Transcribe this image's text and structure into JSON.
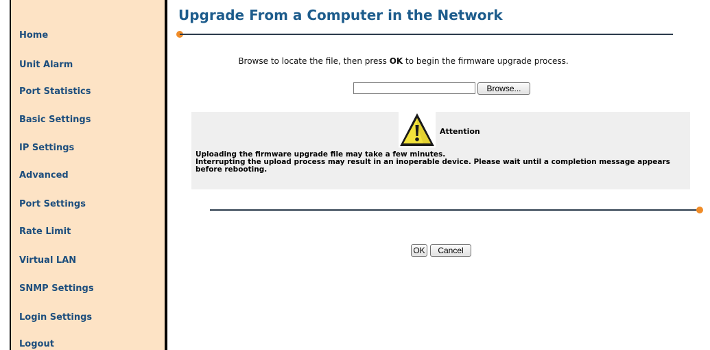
{
  "sidebar": {
    "items": [
      {
        "label": "Home"
      },
      {
        "label": "Unit Alarm"
      },
      {
        "label": "Port Statistics"
      },
      {
        "label": "Basic Settings"
      },
      {
        "label": "IP Settings"
      },
      {
        "label": "Advanced"
      },
      {
        "label": "Port Settings"
      },
      {
        "label": "Rate Limit"
      },
      {
        "label": "Virtual LAN"
      },
      {
        "label": "SNMP Settings"
      },
      {
        "label": "Login Settings"
      },
      {
        "label": "Logout"
      }
    ]
  },
  "main": {
    "title": "Upgrade From a Computer in the Network",
    "instruction_before": "Browse to locate the file, then press ",
    "instruction_bold": "OK",
    "instruction_after": " to begin the firmware upgrade process.",
    "file_input_value": "",
    "browse_label": "Browse...",
    "attention": {
      "icon": "warning-icon",
      "title": "Attention",
      "lines": [
        "Uploading the firmware upgrade file may take a few minutes.",
        "Interrupting the upload process may result in an inoperable device. Please wait until a completion message appears before rebooting."
      ]
    },
    "ok_label": "OK",
    "cancel_label": "Cancel"
  },
  "colors": {
    "sidebar_bg": "#fde3c5",
    "link": "#1d4e7d",
    "title": "#1d5c8c",
    "accent_dot": "#f08c28",
    "rule": "#2b3a4b"
  }
}
